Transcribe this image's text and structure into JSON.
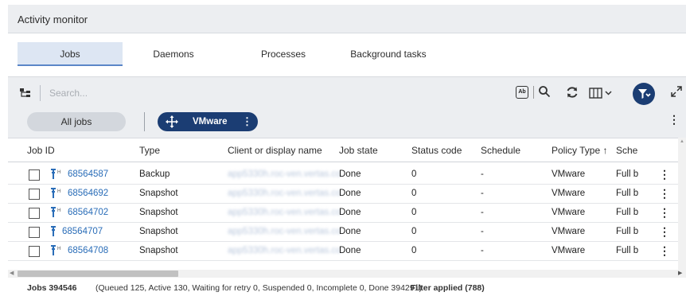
{
  "window": {
    "title": "Activity monitor"
  },
  "tabs": [
    {
      "label": "Jobs",
      "active": true
    },
    {
      "label": "Daemons",
      "active": false
    },
    {
      "label": "Processes",
      "active": false
    },
    {
      "label": "Background tasks",
      "active": false
    }
  ],
  "toolbar": {
    "search_placeholder": "Search...",
    "icons": [
      "tree-view-icon",
      "case-sensitive-icon",
      "search-icon",
      "refresh-icon",
      "columns-icon",
      "filter-icon",
      "expand-icon"
    ],
    "ab_label": "Ab"
  },
  "chips": {
    "all_jobs": "All jobs",
    "vmware": "VMware",
    "kebab": "⋮"
  },
  "table": {
    "columns": [
      "Job ID",
      "Type",
      "Client or display name",
      "Job state",
      "Status code",
      "Schedule",
      "Policy Type ↑",
      "Sche"
    ],
    "rows": [
      {
        "job_id": "68564587",
        "type": "Backup",
        "client": "app5330h.roc-ven.vertas.co",
        "state": "Done",
        "status": "0",
        "schedule": "-",
        "policy": "VMware",
        "sched2": "Full b"
      },
      {
        "job_id": "68564692",
        "type": "Snapshot",
        "client": "app5330h.roc-ven.vertas.co",
        "state": "Done",
        "status": "0",
        "schedule": "-",
        "policy": "VMware",
        "sched2": "Full b"
      },
      {
        "job_id": "68564702",
        "type": "Snapshot",
        "client": "app5330h.roc-ven.vertas.co",
        "state": "Done",
        "status": "0",
        "schedule": "-",
        "policy": "VMware",
        "sched2": "Full b"
      },
      {
        "job_id": "68564707",
        "type": "Snapshot",
        "client": "app5330h.roc-ven.vertas.co",
        "state": "Done",
        "status": "0",
        "schedule": "-",
        "policy": "VMware",
        "sched2": "Full b"
      },
      {
        "job_id": "68564708",
        "type": "Snapshot",
        "client": "app5330h.roc-ven.vertas.co",
        "state": "Done",
        "status": "0",
        "schedule": "-",
        "policy": "VMware",
        "sched2": "Full b"
      }
    ]
  },
  "footer": {
    "total": "Jobs 394546",
    "detail": "(Queued 125, Active 130, Waiting for retry 0, Suspended 0, Incomplete 0, Done 394291)",
    "filter": "Filter applied (788)"
  },
  "colors": {
    "accent": "#1b3d73",
    "link": "#2a6db8",
    "tab_active_bg": "#dde6f3",
    "panel_bg": "#eceef1"
  }
}
